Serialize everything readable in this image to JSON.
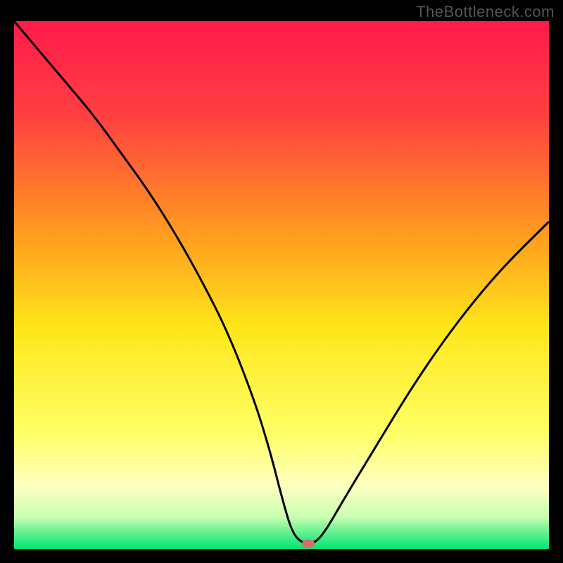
{
  "watermark": "TheBottleneck.com",
  "chart_data": {
    "type": "line",
    "title": "",
    "xlabel": "",
    "ylabel": "",
    "xlim": [
      0,
      100
    ],
    "ylim": [
      0,
      100
    ],
    "background_gradient": {
      "stops": [
        {
          "offset": 0.0,
          "color": "#ff1a4b"
        },
        {
          "offset": 0.18,
          "color": "#ff4040"
        },
        {
          "offset": 0.4,
          "color": "#ff9a1f"
        },
        {
          "offset": 0.58,
          "color": "#ffe61a"
        },
        {
          "offset": 0.78,
          "color": "#ffff66"
        },
        {
          "offset": 0.88,
          "color": "#ffffc0"
        },
        {
          "offset": 0.94,
          "color": "#c8ffb0"
        },
        {
          "offset": 0.97,
          "color": "#5ff090"
        },
        {
          "offset": 1.0,
          "color": "#00e673"
        }
      ]
    },
    "series": [
      {
        "name": "bottleneck-curve",
        "color": "#000000",
        "x": [
          0,
          5,
          10,
          15,
          20,
          25,
          30,
          35,
          40,
          45,
          48,
          50,
          52,
          54,
          56,
          58,
          62,
          68,
          74,
          80,
          86,
          92,
          100
        ],
        "y": [
          100,
          94,
          88,
          82,
          75,
          68,
          60,
          51,
          41,
          28,
          18,
          10,
          3,
          1,
          1,
          3,
          10,
          20,
          30,
          39,
          47,
          54,
          62
        ]
      }
    ],
    "marker": {
      "name": "optimal-point",
      "x": 55,
      "y": 1,
      "color": "#d96b6b",
      "rx": 9,
      "ry": 6
    }
  }
}
